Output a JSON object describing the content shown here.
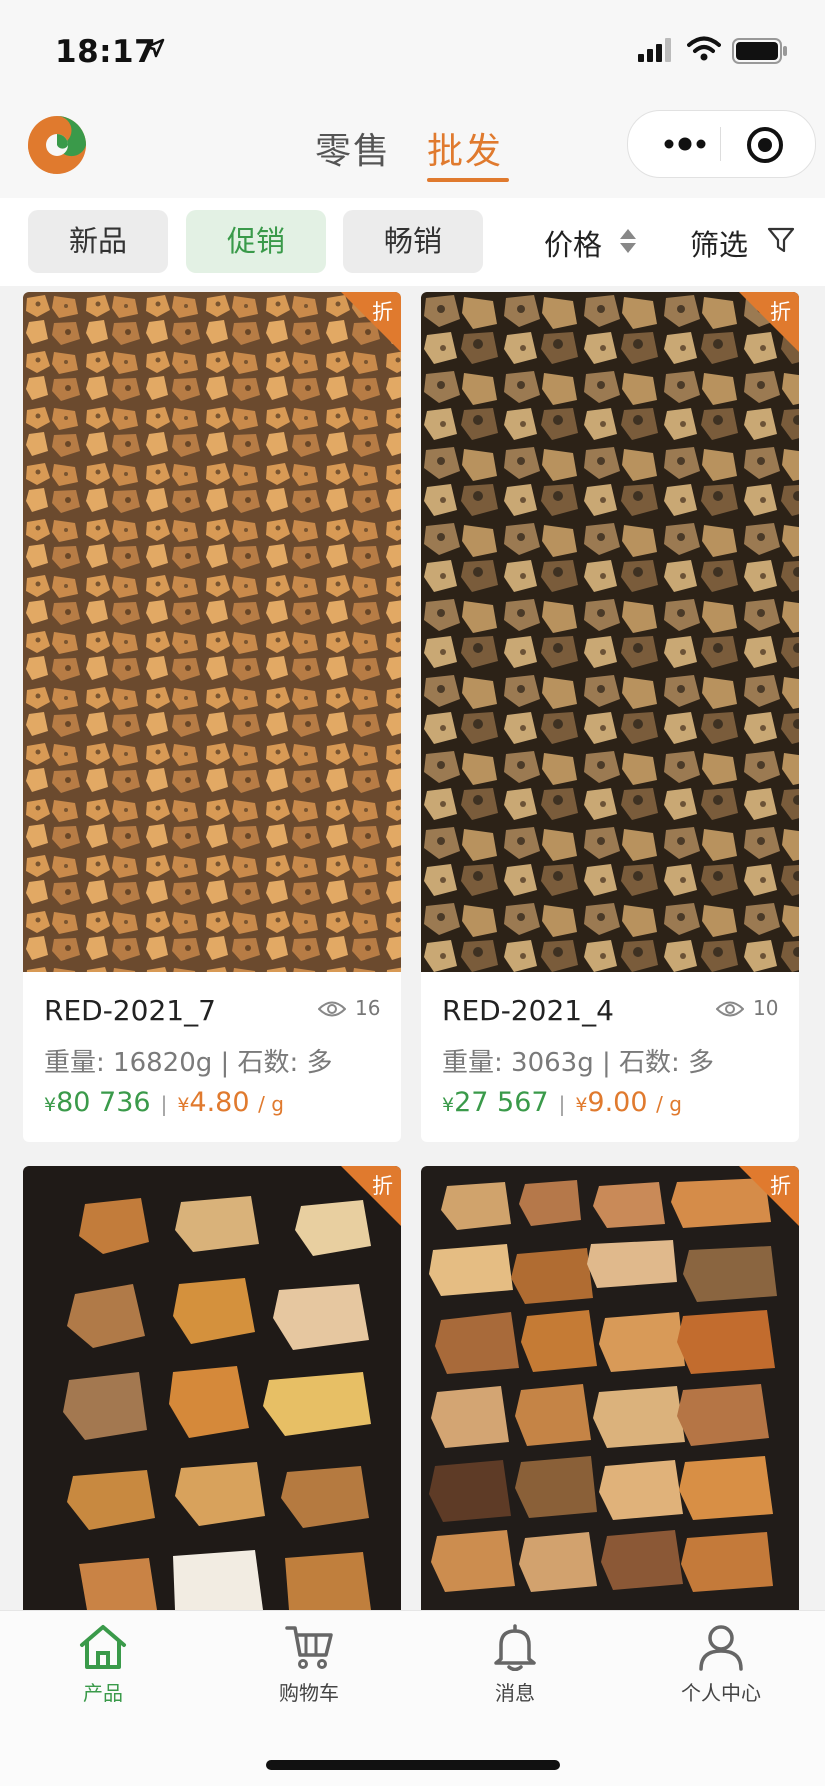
{
  "status_bar": {
    "time": "18:17"
  },
  "header": {
    "tabs": [
      {
        "label": "零售",
        "active": false
      },
      {
        "label": "批发",
        "active": true
      }
    ],
    "accent_color": "#e07a2e"
  },
  "filters": {
    "chips": [
      {
        "label": "新品",
        "active": false
      },
      {
        "label": "促销",
        "active": true
      },
      {
        "label": "畅销",
        "active": false
      }
    ],
    "sort_label": "价格",
    "filter_label": "筛选"
  },
  "products": [
    {
      "badge": "折",
      "name": "RED-2021_7",
      "views": "16",
      "meta": "重量: 16820g | 石数: 多",
      "currency": "¥",
      "total_price": "80 736",
      "unit_price": "4.80",
      "unit_suffix": "/ g"
    },
    {
      "badge": "折",
      "name": "RED-2021_4",
      "views": "10",
      "meta": "重量: 3063g | 石数: 多",
      "currency": "¥",
      "total_price": "27 567",
      "unit_price": "9.00",
      "unit_suffix": "/ g"
    },
    {
      "badge": "折"
    },
    {
      "badge": "折"
    }
  ],
  "bottom_nav": [
    {
      "label": "产品",
      "icon": "home-icon",
      "active": true
    },
    {
      "label": "购物车",
      "icon": "cart-icon",
      "active": false
    },
    {
      "label": "消息",
      "icon": "bell-icon",
      "active": false
    },
    {
      "label": "个人中心",
      "icon": "user-icon",
      "active": false
    }
  ],
  "colors": {
    "green": "#3a9a4a",
    "orange": "#e07a2e"
  }
}
